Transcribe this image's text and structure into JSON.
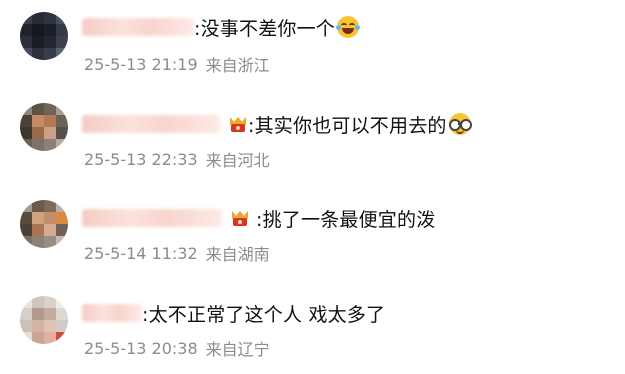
{
  "comments": [
    {
      "text": ":没事不差你一个",
      "emoji": "laughing-tears-emoji",
      "time": "25-5-13 21:19",
      "location": "来自浙江"
    },
    {
      "text": ":其实你也可以不用去的",
      "emoji": "glasses-emoji",
      "badge": "crown-badge-icon",
      "time": "25-5-13 22:33",
      "location": "来自河北"
    },
    {
      "text": ":挑了一条最便宜的泼",
      "badge": "crown-badge-icon",
      "time": "25-5-14 11:32",
      "location": "来自湖南"
    },
    {
      "text": ":太不正常了这个人 戏太多了",
      "time": "25-5-13 20:38",
      "location": "来自辽宁"
    }
  ],
  "colors": {
    "text": "#111111",
    "meta": "#8c8c8c",
    "name_mosaic": "#f6c9c2",
    "badge_gold": "#e9a92b",
    "badge_red": "#d8322c"
  }
}
